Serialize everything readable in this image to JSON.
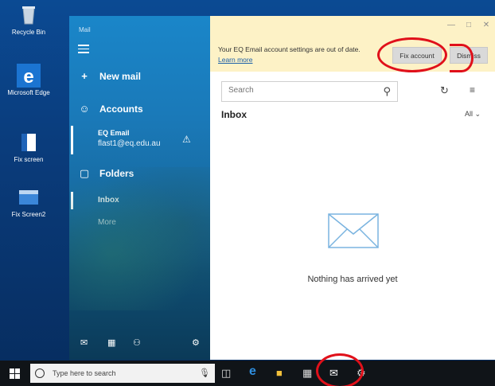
{
  "desktop": {
    "icons": [
      {
        "label": "Recycle Bin",
        "icon": "recycle-bin-icon"
      },
      {
        "label": "Microsoft Edge",
        "icon": "edge-icon"
      },
      {
        "label": "Fix screen",
        "icon": "window-icon"
      },
      {
        "label": "Fix Screen2",
        "icon": "window-icon"
      }
    ]
  },
  "nav": {
    "app_title": "Mail",
    "new_mail": "New mail",
    "accounts": "Accounts",
    "account": {
      "name": "EQ Email",
      "email": "flast1@eq.edu.au"
    },
    "folders": "Folders",
    "inbox": "Inbox",
    "more": "More"
  },
  "banner": {
    "message": "Your EQ Email account settings are out of date.",
    "learn_more": "Learn more",
    "fix_account": "Fix account",
    "dismiss": "Dismiss"
  },
  "search": {
    "placeholder": "Search"
  },
  "list": {
    "title": "Inbox",
    "filter": "All",
    "empty_text": "Nothing has arrived yet"
  },
  "taskbar": {
    "search_placeholder": "Type here to search"
  },
  "colors": {
    "accent": "#1a7fc0",
    "annotation": "#e0101a",
    "banner": "#fdf2c6"
  }
}
